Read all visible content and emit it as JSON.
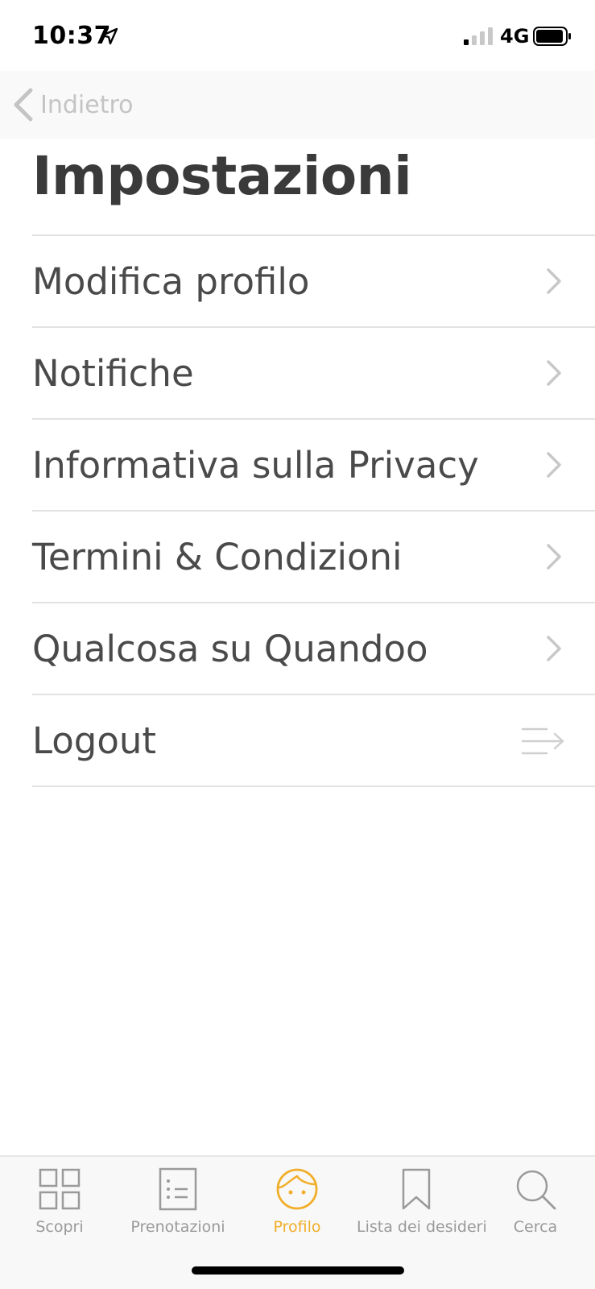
{
  "status_bar": {
    "time": "10:37",
    "network": "4G",
    "icons": [
      "location-arrow-icon",
      "signal-bars-icon",
      "battery-icon"
    ]
  },
  "nav": {
    "back_label": "Indietro",
    "back_icon": "chevron-left-icon"
  },
  "page_title": "Impostazioni",
  "settings": {
    "items": [
      {
        "label": "Modifica profilo",
        "icon": "chevron-right-icon"
      },
      {
        "label": "Notifiche",
        "icon": "chevron-right-icon"
      },
      {
        "label": "Informativa sulla Privacy",
        "icon": "chevron-right-icon"
      },
      {
        "label": "Termini & Condizioni",
        "icon": "chevron-right-icon"
      },
      {
        "label": "Qualcosa su Quandoo",
        "icon": "chevron-right-icon"
      },
      {
        "label": "Logout",
        "icon": "logout-arrow-icon"
      }
    ]
  },
  "tab_bar": {
    "tabs": [
      {
        "label": "Scopri",
        "icon": "grid-icon",
        "active": false
      },
      {
        "label": "Prenotazioni",
        "icon": "list-icon",
        "active": false
      },
      {
        "label": "Profilo",
        "icon": "face-icon",
        "active": true
      },
      {
        "label": "Lista dei desideri",
        "icon": "bookmark-icon",
        "active": false
      },
      {
        "label": "Cerca",
        "icon": "search-icon",
        "active": false
      }
    ]
  },
  "colors": {
    "accent": "#f1ae29",
    "text": "#4a4a4a",
    "title": "#3a3a3a",
    "inactive": "#9a9a9a",
    "divider": "#e2e2e2"
  }
}
